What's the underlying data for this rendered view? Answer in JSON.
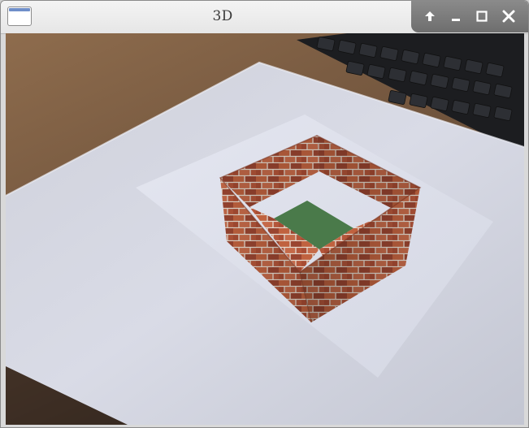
{
  "window": {
    "title": "3D",
    "controls": [
      {
        "icon": "arrow-up-icon"
      },
      {
        "icon": "minimize-icon"
      },
      {
        "icon": "maximize-icon"
      },
      {
        "icon": "close-icon"
      }
    ]
  },
  "scene": {
    "floor_color": "#4a7a4a",
    "brick_color": "#b0553a",
    "mortar_color": "#e6dcd0",
    "paper_color": "#d9dce6",
    "table_color": "#7a5a3e"
  }
}
